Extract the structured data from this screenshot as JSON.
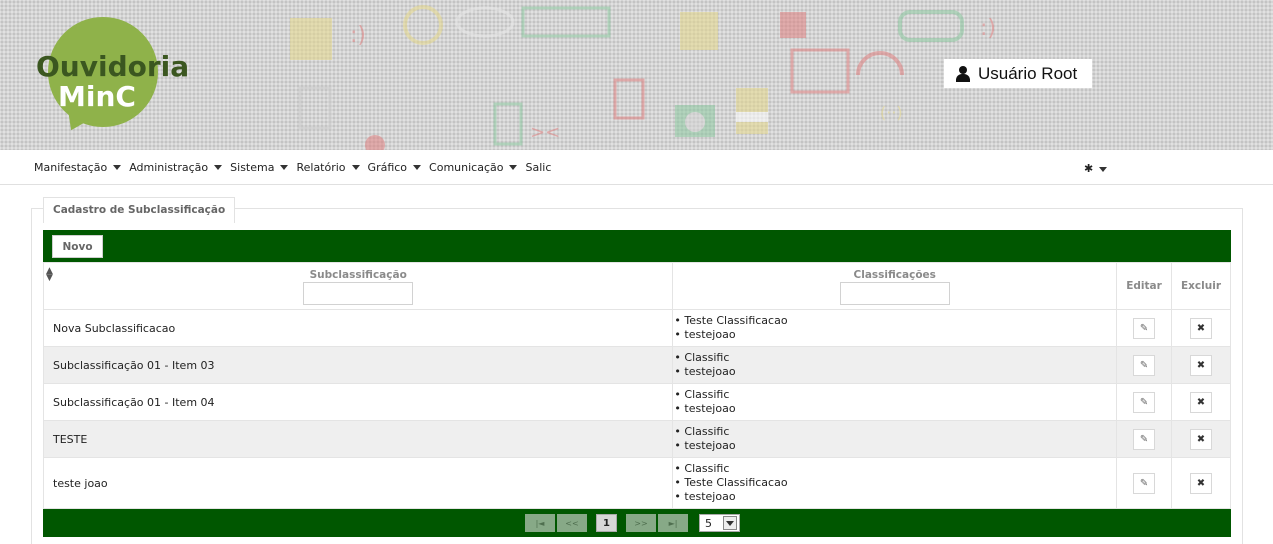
{
  "header": {
    "logo_line1": "Ouvidoria",
    "logo_line2": "MinC",
    "user_name": "Usuário Root"
  },
  "menu": {
    "items": [
      {
        "label": "Manifestação",
        "has_dropdown": true
      },
      {
        "label": "Administração",
        "has_dropdown": true
      },
      {
        "label": "Sistema",
        "has_dropdown": true
      },
      {
        "label": "Relatório",
        "has_dropdown": true
      },
      {
        "label": "Gráfico",
        "has_dropdown": true
      },
      {
        "label": "Comunicação",
        "has_dropdown": true
      },
      {
        "label": "Salic",
        "has_dropdown": false
      }
    ],
    "settings_icon": "gear-icon"
  },
  "panel": {
    "title": "Cadastro de Subclassificação",
    "new_button": "Novo"
  },
  "table": {
    "columns": {
      "subclassificacao": "Subclassificação",
      "classificacoes": "Classificações",
      "editar": "Editar",
      "excluir": "Excluir"
    },
    "filters": {
      "subclassificacao": "",
      "classificacoes": ""
    },
    "rows": [
      {
        "name": "Nova Subclassificacao",
        "classifications": [
          "Teste Classificacao",
          "testejoao"
        ]
      },
      {
        "name": "Subclassificação 01 - Item 03",
        "classifications": [
          "Classific",
          "testejoao"
        ]
      },
      {
        "name": "Subclassificação 01 - Item 04",
        "classifications": [
          "Classific",
          "testejoao"
        ]
      },
      {
        "name": "TESTE",
        "classifications": [
          "Classific",
          "testejoao"
        ]
      },
      {
        "name": "teste joao",
        "classifications": [
          "Classific",
          "Teste Classificacao",
          "testejoao"
        ]
      }
    ]
  },
  "pagination": {
    "first": "|◄",
    "prev": "<<",
    "current_page": "1",
    "next": ">>",
    "last": "►|",
    "page_size": "5"
  },
  "colors": {
    "brand_green": "#005700",
    "logo_green": "#8fb24a"
  }
}
